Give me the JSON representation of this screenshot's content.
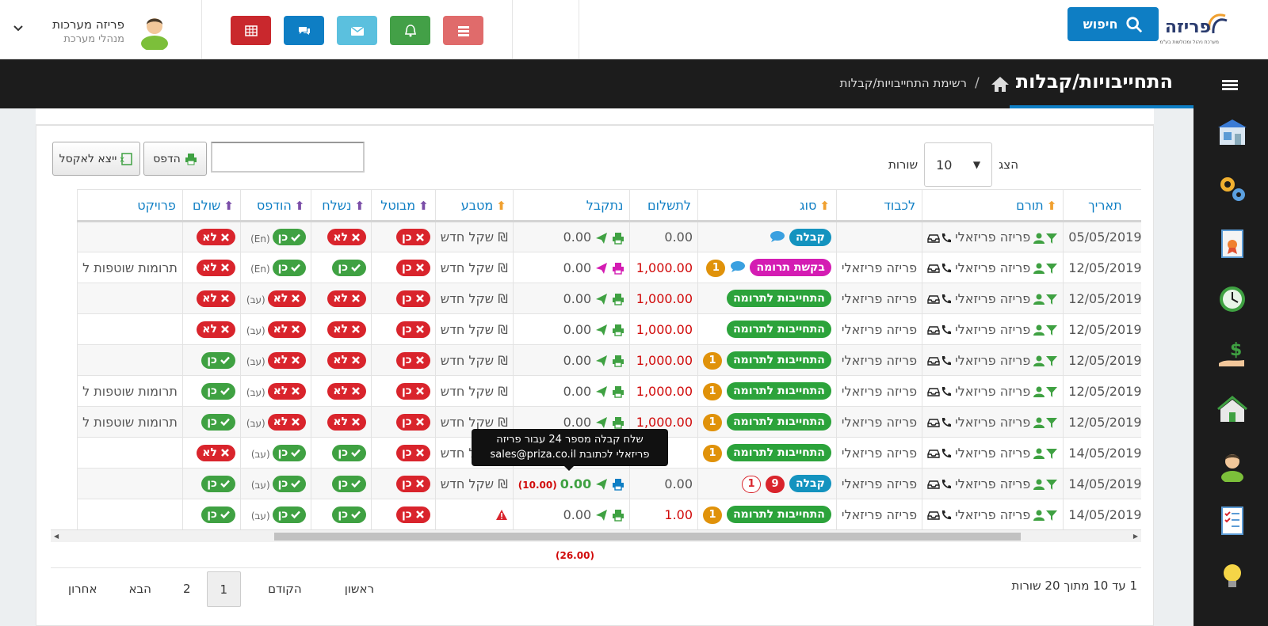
{
  "header": {
    "logo_text": "פריזה",
    "logo_tagline": "מערכת ניהול ומכולשות בע\"מ",
    "search_label": "חיפוש",
    "user_name": "פריזה מערכות",
    "user_role": "מנהלי מערכת"
  },
  "titlebar": {
    "page_title": "התחייבויות/קבלות",
    "breadcrumb_sep": "/",
    "breadcrumb": "רשימת התחייבויות/קבלות"
  },
  "controls": {
    "show_label": "הצג",
    "rows_value": "10",
    "rows_label": "שורות",
    "print_label": "הדפס",
    "excel_label": "ייצא לאקסל",
    "filter_placeholder": ""
  },
  "table": {
    "columns": [
      "תאריך",
      "תורם",
      "לכבוד",
      "סוג",
      "לתשלום",
      "נתקבל",
      "מטבע",
      "מבוטל",
      "נשלח",
      "הודפס",
      "שולם",
      "פרויקט"
    ],
    "rows": [
      {
        "date": "05/05/2019",
        "donor": "פריזה פריזאלי",
        "honor": "",
        "type": "קבלה",
        "type_kind": "receipt",
        "badges": [],
        "chat": true,
        "pay": "0.00",
        "pay_red": false,
        "recv": "0.00",
        "recv_refund": "",
        "recv_pink": false,
        "currency": "₪ שקל חדש",
        "cancel": "כן",
        "cancel_yes": false,
        "sent": "לא",
        "sent_yes": false,
        "printed": "כן",
        "printed_yes": true,
        "printed_tag": "(En)",
        "paid": "לא",
        "paid_yes": false,
        "project": ""
      },
      {
        "date": "12/05/2019",
        "donor": "פריזה פריזאלי",
        "honor": "פריזה פריזאלי",
        "type": "בקשת תרומה",
        "type_kind": "req",
        "badges": [
          {
            "kind": "o",
            "text": "1"
          }
        ],
        "chat": true,
        "pay": "1,000.00",
        "pay_red": true,
        "recv": "0.00",
        "recv_refund": "",
        "recv_pink": true,
        "currency": "₪ שקל חדש",
        "cancel": "כן",
        "cancel_yes": false,
        "sent": "כן",
        "sent_yes": true,
        "printed": "כן",
        "printed_yes": true,
        "printed_tag": "(En)",
        "paid": "לא",
        "paid_yes": false,
        "project": "תרומות שוטפות ל"
      },
      {
        "date": "12/05/2019",
        "donor": "פריזה פריזאלי",
        "honor": "פריזה פריזאלי",
        "type": "התחייבות לתרומה",
        "type_kind": "com",
        "badges": [],
        "chat": false,
        "pay": "1,000.00",
        "pay_red": true,
        "recv": "0.00",
        "recv_refund": "",
        "recv_pink": false,
        "currency": "₪ שקל חדש",
        "cancel": "כן",
        "cancel_yes": false,
        "sent": "לא",
        "sent_yes": false,
        "printed": "לא",
        "printed_yes": false,
        "printed_tag": "(עב)",
        "paid": "לא",
        "paid_yes": false,
        "project": ""
      },
      {
        "date": "12/05/2019",
        "donor": "פריזה פריזאלי",
        "honor": "פריזה פריזאלי",
        "type": "התחייבות לתרומה",
        "type_kind": "com",
        "badges": [],
        "chat": false,
        "pay": "1,000.00",
        "pay_red": true,
        "recv": "0.00",
        "recv_refund": "",
        "recv_pink": false,
        "currency": "₪ שקל חדש",
        "cancel": "כן",
        "cancel_yes": false,
        "sent": "לא",
        "sent_yes": false,
        "printed": "לא",
        "printed_yes": false,
        "printed_tag": "(עב)",
        "paid": "לא",
        "paid_yes": false,
        "project": ""
      },
      {
        "date": "12/05/2019",
        "donor": "פריזה פריזאלי",
        "honor": "פריזה פריזאלי",
        "type": "התחייבות לתרומה",
        "type_kind": "com",
        "badges": [
          {
            "kind": "o",
            "text": "1"
          }
        ],
        "chat": false,
        "pay": "1,000.00",
        "pay_red": true,
        "recv": "0.00",
        "recv_refund": "",
        "recv_pink": false,
        "currency": "₪ שקל חדש",
        "cancel": "כן",
        "cancel_yes": false,
        "sent": "לא",
        "sent_yes": false,
        "printed": "לא",
        "printed_yes": false,
        "printed_tag": "(עב)",
        "paid": "כן",
        "paid_yes": true,
        "project": ""
      },
      {
        "date": "12/05/2019",
        "donor": "פריזה פריזאלי",
        "honor": "פריזה פריזאלי",
        "type": "התחייבות לתרומה",
        "type_kind": "com",
        "badges": [
          {
            "kind": "o",
            "text": "1"
          }
        ],
        "chat": false,
        "pay": "1,000.00",
        "pay_red": true,
        "recv": "0.00",
        "recv_refund": "",
        "recv_pink": false,
        "currency": "₪ שקל חדש",
        "cancel": "כן",
        "cancel_yes": false,
        "sent": "לא",
        "sent_yes": false,
        "printed": "לא",
        "printed_yes": false,
        "printed_tag": "(עב)",
        "paid": "כן",
        "paid_yes": true,
        "project": "תרומות שוטפות ל"
      },
      {
        "date": "12/05/2019",
        "donor": "פריזה פריזאלי",
        "honor": "פריזה פריזאלי",
        "type": "התחייבות לתרומה",
        "type_kind": "com",
        "badges": [
          {
            "kind": "o",
            "text": "1"
          }
        ],
        "chat": false,
        "pay": "1,000.00",
        "pay_red": true,
        "recv": "0.00",
        "recv_refund": "",
        "recv_pink": false,
        "currency": "₪ שקל חדש",
        "cancel": "כן",
        "cancel_yes": false,
        "sent": "לא",
        "sent_yes": false,
        "printed": "לא",
        "printed_yes": false,
        "printed_tag": "(עב)",
        "paid": "כן",
        "paid_yes": true,
        "project": "תרומות שוטפות ל"
      },
      {
        "date": "14/05/2019",
        "donor": "פריזה פריזאלי",
        "honor": "פריזה פריזאלי",
        "type": "התחייבות לתרומה",
        "type_kind": "com",
        "badges": [
          {
            "kind": "o",
            "text": "1"
          }
        ],
        "chat": false,
        "pay": "",
        "pay_red": true,
        "recv": "",
        "recv_refund": "",
        "recv_pink": false,
        "currency": "₪ שקל חדש",
        "cancel": "כן",
        "cancel_yes": false,
        "sent": "כן",
        "sent_yes": true,
        "printed": "כן",
        "printed_yes": true,
        "printed_tag": "(עב)",
        "paid": "לא",
        "paid_yes": false,
        "project": ""
      },
      {
        "date": "14/05/2019",
        "donor": "פריזה פריזאלי",
        "honor": "פריזה פריזאלי",
        "type": "קבלה",
        "type_kind": "receipt",
        "badges": [
          {
            "kind": "ro",
            "text": "1"
          },
          {
            "kind": "r",
            "text": "9"
          }
        ],
        "chat": false,
        "pay": "0.00",
        "pay_red": false,
        "recv": "0.00",
        "recv_refund": "(10.00)",
        "recv_pink": false,
        "recv_green": true,
        "currency": "₪ שקל חדש",
        "cancel": "כן",
        "cancel_yes": false,
        "sent": "כן",
        "sent_yes": true,
        "printed": "כן",
        "printed_yes": true,
        "printed_tag": "(עב)",
        "paid": "כן",
        "paid_yes": true,
        "project": ""
      },
      {
        "date": "14/05/2019",
        "donor": "פריזה פריזאלי",
        "honor": "פריזה פריזאלי",
        "type": "התחייבות לתרומה",
        "type_kind": "com",
        "badges": [
          {
            "kind": "o",
            "text": "1"
          }
        ],
        "chat": false,
        "pay": "1.00",
        "pay_red": true,
        "recv": "0.00",
        "recv_refund": "",
        "recv_pink": false,
        "currency": "",
        "currency_warn": true,
        "cancel": "כן",
        "cancel_yes": false,
        "sent": "כן",
        "sent_yes": true,
        "printed": "כן",
        "printed_yes": true,
        "printed_tag": "(עב)",
        "paid": "כן",
        "paid_yes": true,
        "project": ""
      }
    ],
    "footer_total": "(26.00)"
  },
  "tooltip": {
    "line1": "שלח קבלה מספר 24 עבור פריזה",
    "line2": "פריזאלי לכתובת sales@priza.co.il"
  },
  "pager": {
    "first": "ראשון",
    "prev": "הקודם",
    "page1": "1",
    "page2": "2",
    "next": "הבא",
    "last": "אחרון",
    "count_text": "1 עד 10 מתוך 20 שורות"
  },
  "colors": {
    "accent": "#0e7ec4",
    "dark": "#1c1c1c",
    "yes": "#3fa142",
    "no": "#d9242c",
    "request": "#d41cb3",
    "badge": "#e0920a"
  }
}
